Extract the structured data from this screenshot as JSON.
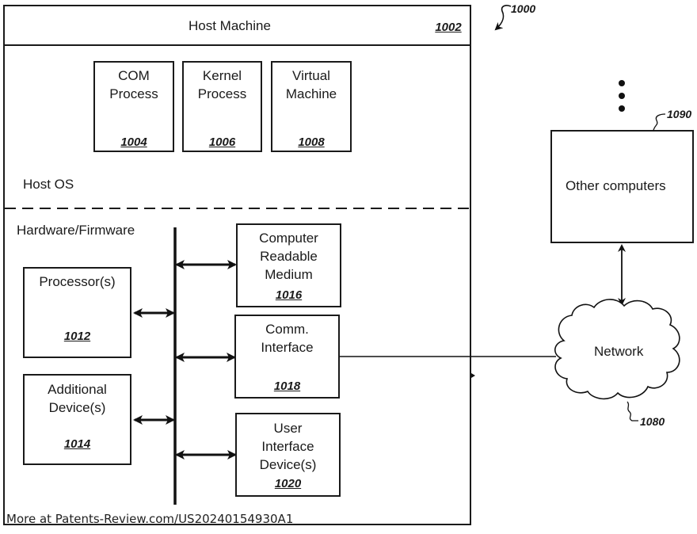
{
  "figure": {
    "ref": "1000"
  },
  "host_machine": {
    "title": "Host Machine",
    "ref": "1002",
    "host_os_label": "Host OS",
    "hardware_label": "Hardware/Firmware",
    "processes": [
      {
        "label": "COM\nProcess",
        "ref": "1004"
      },
      {
        "label": "Kernel\nProcess",
        "ref": "1006"
      },
      {
        "label": "Virtual\nMachine",
        "ref": "1008"
      }
    ],
    "hardware": {
      "processor": {
        "label": "Processor(s)",
        "ref": "1012"
      },
      "additional": {
        "label": "Additional\nDevice(s)",
        "ref": "1014"
      },
      "crm": {
        "label": "Computer\nReadable\nMedium",
        "ref": "1016"
      },
      "comm": {
        "label": "Comm.\nInterface",
        "ref": "1018"
      },
      "ui": {
        "label": "User\nInterface\nDevice(s)",
        "ref": "1020"
      }
    }
  },
  "network": {
    "label": "Network",
    "ref": "1080"
  },
  "other_computers": {
    "label": "Other computers",
    "ref": "1090"
  },
  "watermark": "More at Patents-Review.com/US20240154930A1"
}
